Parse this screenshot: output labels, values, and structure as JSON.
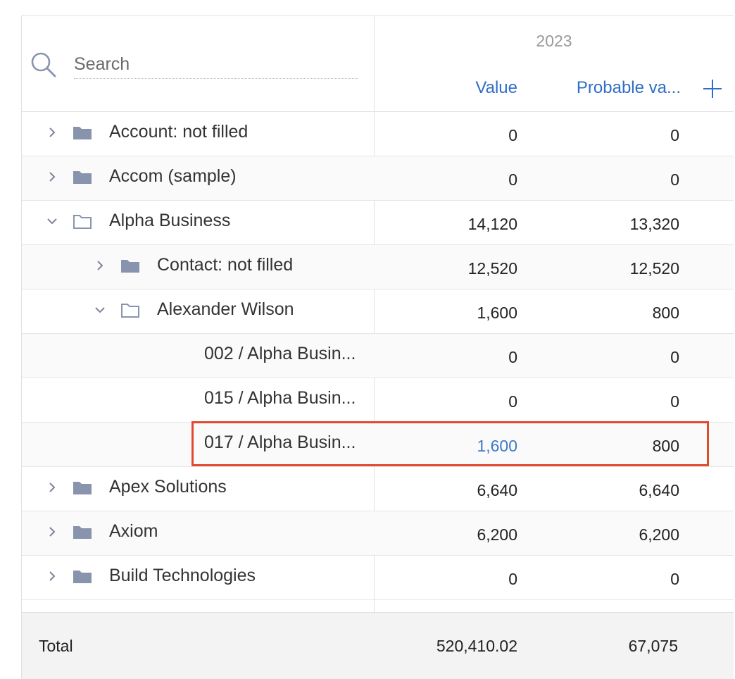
{
  "search": {
    "placeholder": "Search"
  },
  "header": {
    "year": "2023",
    "columns": {
      "value": "Value",
      "probable_value": "Probable va..."
    },
    "add_label": "+"
  },
  "rows": [
    {
      "label": "Account: not filled",
      "value": "0",
      "probable": "0",
      "level": 0,
      "expanded": false,
      "type": "folder"
    },
    {
      "label": "Accom (sample)",
      "value": "0",
      "probable": "0",
      "level": 0,
      "expanded": false,
      "type": "folder"
    },
    {
      "label": "Alpha Business",
      "value": "14,120",
      "probable": "13,320",
      "level": 0,
      "expanded": true,
      "type": "folder"
    },
    {
      "label": "Contact: not filled",
      "value": "12,520",
      "probable": "12,520",
      "level": 1,
      "expanded": false,
      "type": "folder"
    },
    {
      "label": "Alexander Wilson",
      "value": "1,600",
      "probable": "800",
      "level": 1,
      "expanded": true,
      "type": "folder"
    },
    {
      "label": "002 / Alpha Busin...",
      "value": "0",
      "probable": "0",
      "level": 2,
      "type": "record"
    },
    {
      "label": "015 / Alpha Busin...",
      "value": "0",
      "probable": "0",
      "level": 2,
      "type": "record"
    },
    {
      "label": "017 / Alpha Busin...",
      "value": "1,600",
      "probable": "800",
      "level": 2,
      "type": "record",
      "value_link": true
    },
    {
      "label": "Apex Solutions",
      "value": "6,640",
      "probable": "6,640",
      "level": 0,
      "expanded": false,
      "type": "folder"
    },
    {
      "label": "Axiom",
      "value": "6,200",
      "probable": "6,200",
      "level": 0,
      "expanded": false,
      "type": "folder"
    },
    {
      "label": "Build Technologies",
      "value": "0",
      "probable": "0",
      "level": 0,
      "expanded": false,
      "type": "folder"
    }
  ],
  "total": {
    "label": "Total",
    "value": "520,410.02",
    "probable": "67,075"
  },
  "colors": {
    "accent": "#2f6dc6",
    "folder": "#8894ad",
    "highlight": "#e14a2f"
  }
}
